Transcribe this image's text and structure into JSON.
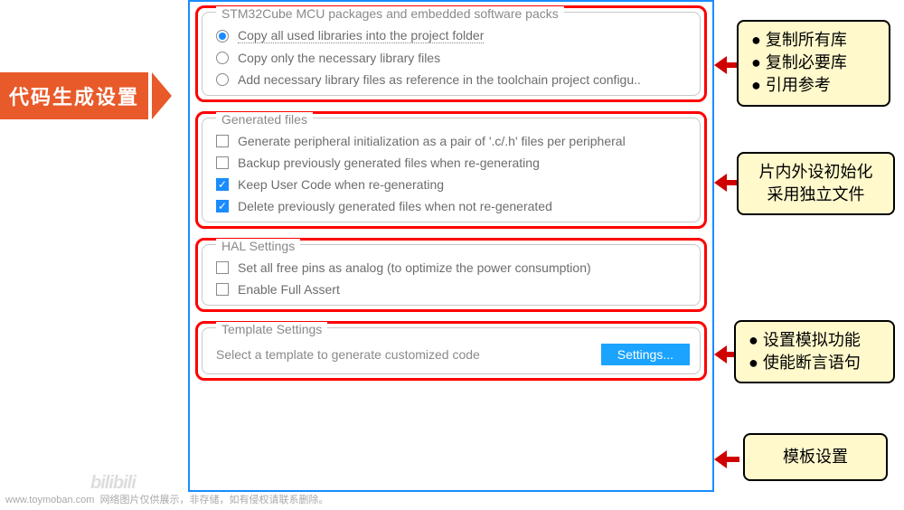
{
  "title_banner": "代码生成设置",
  "groups": {
    "packages": {
      "legend": "STM32Cube MCU packages and embedded software packs",
      "options": [
        "Copy all used libraries into the project folder",
        "Copy only the necessary library files",
        "Add necessary library files as reference in the toolchain project configu.."
      ],
      "selected": 0
    },
    "generated": {
      "legend": "Generated files",
      "options": [
        {
          "label": "Generate peripheral initialization as a pair of '.c/.h' files per peripheral",
          "checked": false
        },
        {
          "label": "Backup previously generated files when re-generating",
          "checked": false
        },
        {
          "label": "Keep User Code when re-generating",
          "checked": true
        },
        {
          "label": "Delete previously generated files when not re-generated",
          "checked": true
        }
      ]
    },
    "hal": {
      "legend": "HAL Settings",
      "options": [
        {
          "label": "Set all free pins as analog (to optimize the power consumption)",
          "checked": false
        },
        {
          "label": "Enable Full Assert",
          "checked": false
        }
      ]
    },
    "template": {
      "legend": "Template Settings",
      "text": "Select a template to generate customized code",
      "button": "Settings..."
    }
  },
  "callouts": {
    "packages": [
      "复制所有库",
      "复制必要库",
      "引用参考"
    ],
    "generated_line1": "片内外设初始化",
    "generated_line2": "采用独立文件",
    "hal": [
      "设置模拟功能",
      "使能断言语句"
    ],
    "template": "模板设置"
  },
  "watermark": {
    "url": "www.toymoban.com",
    "text": "网络图片仅供展示，非存储，如有侵权请联系删除。"
  }
}
